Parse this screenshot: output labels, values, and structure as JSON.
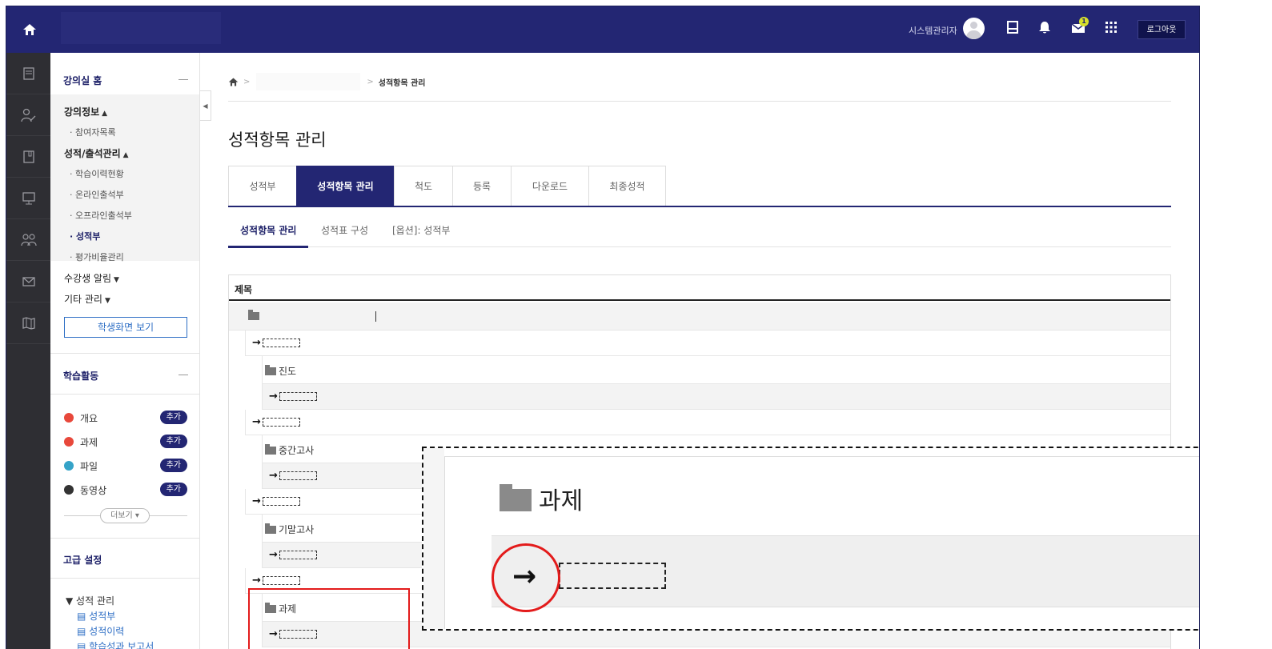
{
  "header": {
    "user_name": "시스템관리자",
    "notification_count": "1",
    "logout_label": "로그아웃"
  },
  "sidebar": {
    "course_home": "강의실 홈",
    "course_info": "강의정보",
    "participants": "참여자목록",
    "grades_attendance": "성적/출석관리",
    "learning_history": "학습이력현황",
    "online_attendance": "온라인출석부",
    "offline_attendance": "오프라인출석부",
    "gradebook": "성적부",
    "weight_manage": "평가비율관리",
    "student_notice": "수강생 알림",
    "other_manage": "기타 관리",
    "student_view_button": "학생화면 보기",
    "activities_title": "학습활동",
    "activities": [
      {
        "label": "개요",
        "add": "추가",
        "color": "#e8483b"
      },
      {
        "label": "과제",
        "add": "추가",
        "color": "#e8483b"
      },
      {
        "label": "파일",
        "add": "추가",
        "color": "#35a3c8"
      },
      {
        "label": "동영상",
        "add": "추가",
        "color": "#333333"
      }
    ],
    "more_button": "더보기",
    "advanced_title": "고급 설정",
    "grade_manage": "성적 관리",
    "grade_links": [
      "성적부",
      "성적이력",
      "학습성과 보고서"
    ]
  },
  "breadcrumb": {
    "current": "성적항목 관리"
  },
  "page_title": "성적항목 관리",
  "tabs": [
    "성적부",
    "성적항목 관리",
    "척도",
    "등록",
    "다운로드",
    "최종성적"
  ],
  "subtabs": [
    "성적항목 관리",
    "성적표 구성",
    "[옵션]: 성적부"
  ],
  "table": {
    "header": "제목",
    "rows": [
      {
        "type": "category",
        "label": "",
        "indent": 0
      },
      {
        "type": "item",
        "label": "→",
        "indent": 1
      },
      {
        "type": "category",
        "label": "진도",
        "indent": 2
      },
      {
        "type": "item",
        "label": "→",
        "indent": 2
      },
      {
        "type": "item",
        "label": "→",
        "indent": 1
      },
      {
        "type": "category",
        "label": "중간고사",
        "indent": 2
      },
      {
        "type": "item",
        "label": "→",
        "indent": 2
      },
      {
        "type": "item",
        "label": "→",
        "indent": 1
      },
      {
        "type": "category",
        "label": "기말고사",
        "indent": 2
      },
      {
        "type": "item",
        "label": "→",
        "indent": 2
      },
      {
        "type": "item",
        "label": "→",
        "indent": 1
      },
      {
        "type": "category",
        "label": "과제",
        "indent": 2
      },
      {
        "type": "item",
        "label": "→",
        "indent": 2
      }
    ]
  },
  "zoom": {
    "folder_label": "과제",
    "arrow": "→"
  },
  "colors": {
    "brand": "#232673",
    "highlight_red": "#e31b1b"
  }
}
